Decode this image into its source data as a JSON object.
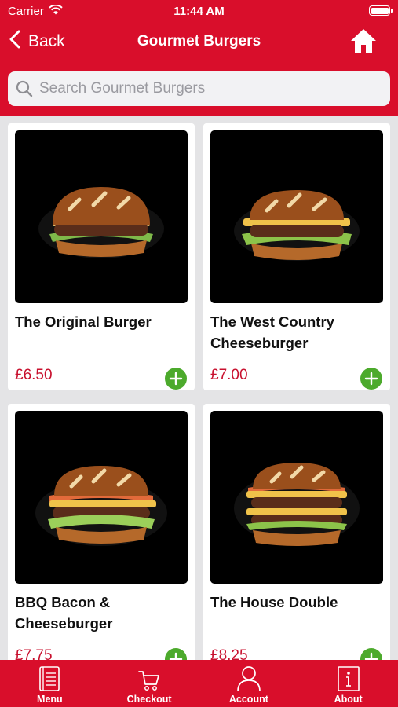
{
  "status_bar": {
    "carrier": "Carrier",
    "time": "11:44 AM",
    "battery_level": 1.0
  },
  "nav": {
    "back_label": "Back",
    "title": "Gourmet Burgers"
  },
  "search": {
    "placeholder": "Search Gourmet Burgers",
    "value": ""
  },
  "products": [
    {
      "name": "The Original Burger",
      "price": "£6.50"
    },
    {
      "name": "The West Country Cheeseburger",
      "price": "£7.00"
    },
    {
      "name": "BBQ Bacon & Cheeseburger",
      "price": "£7.75"
    },
    {
      "name": "The House Double",
      "price": "£8.25"
    }
  ],
  "tabs": [
    {
      "label": "Menu",
      "icon": "menu-book-icon"
    },
    {
      "label": "Checkout",
      "icon": "cart-icon"
    },
    {
      "label": "Account",
      "icon": "person-icon"
    },
    {
      "label": "About",
      "icon": "info-icon"
    }
  ],
  "colors": {
    "brand": "#d90e2b",
    "price": "#c8102e",
    "add": "#4caa2c"
  }
}
